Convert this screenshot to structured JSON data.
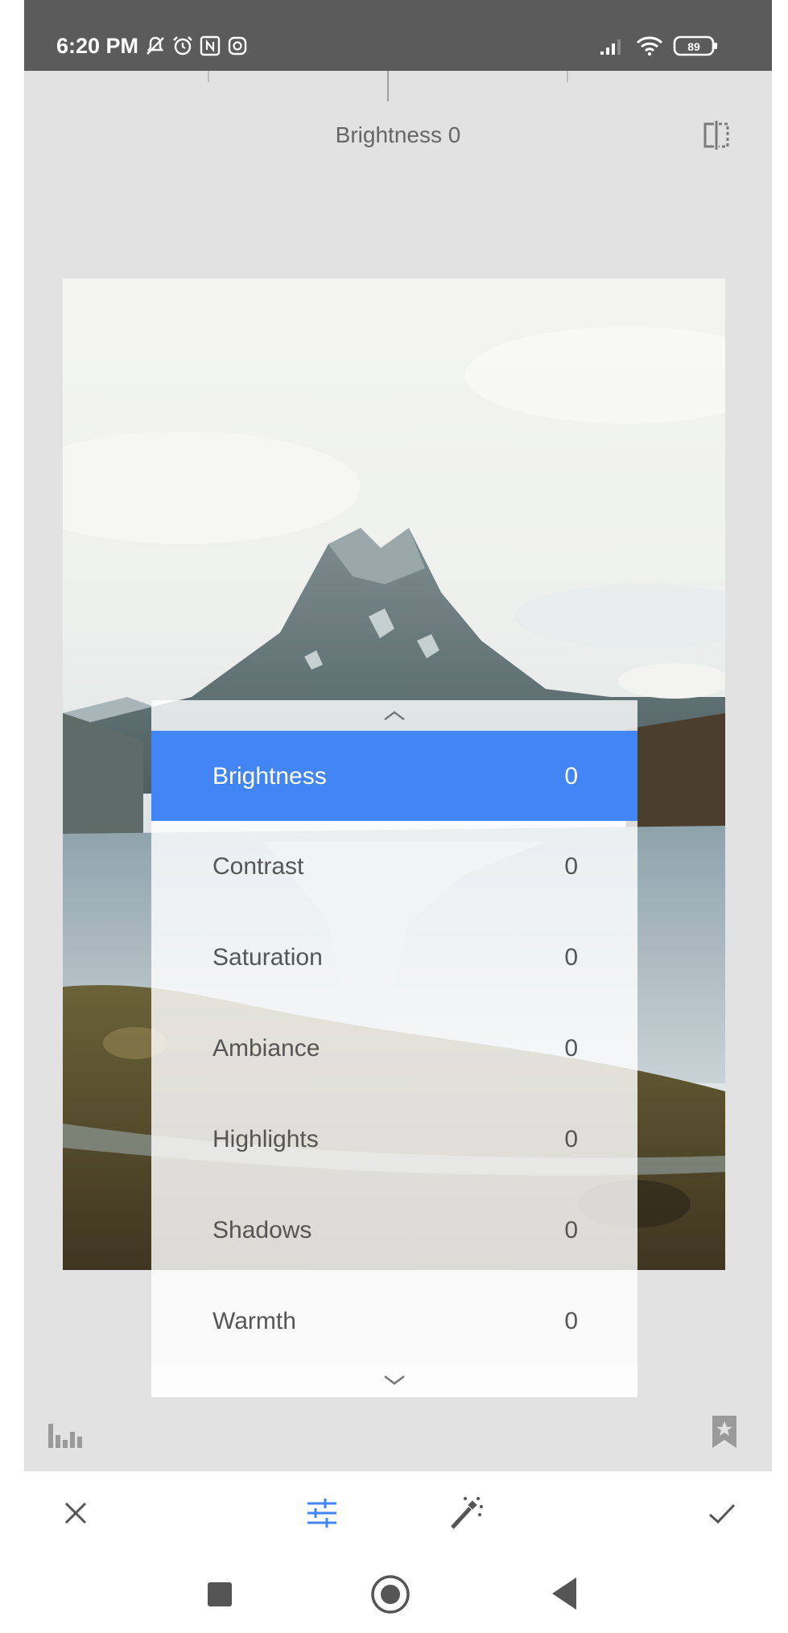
{
  "status_bar": {
    "time": "6:20 PM",
    "battery": "89"
  },
  "header": {
    "title_label": "Brightness",
    "title_value": "0"
  },
  "panel": {
    "items": [
      {
        "label": "Brightness",
        "value": "0",
        "selected": true
      },
      {
        "label": "Contrast",
        "value": "0",
        "selected": false
      },
      {
        "label": "Saturation",
        "value": "0",
        "selected": false
      },
      {
        "label": "Ambiance",
        "value": "0",
        "selected": false
      },
      {
        "label": "Highlights",
        "value": "0",
        "selected": false
      },
      {
        "label": "Shadows",
        "value": "0",
        "selected": false
      },
      {
        "label": "Warmth",
        "value": "0",
        "selected": false
      }
    ]
  },
  "colors": {
    "accent": "#4285f4",
    "status_bar": "#5b5b5b",
    "background": "#e2e2e2"
  },
  "icons": {
    "status": [
      "notification-muted-icon",
      "alarm-icon",
      "nfc-icon",
      "instagram-icon",
      "signal-icon",
      "wifi-icon",
      "battery-icon"
    ],
    "header": [
      "compare-icon"
    ],
    "bottom": [
      "histogram-icon",
      "bookmark-icon"
    ],
    "toolbar": [
      "close-icon",
      "tune-icon",
      "magic-wand-icon",
      "check-icon"
    ],
    "nav": [
      "recents-icon",
      "home-icon",
      "back-icon"
    ]
  }
}
